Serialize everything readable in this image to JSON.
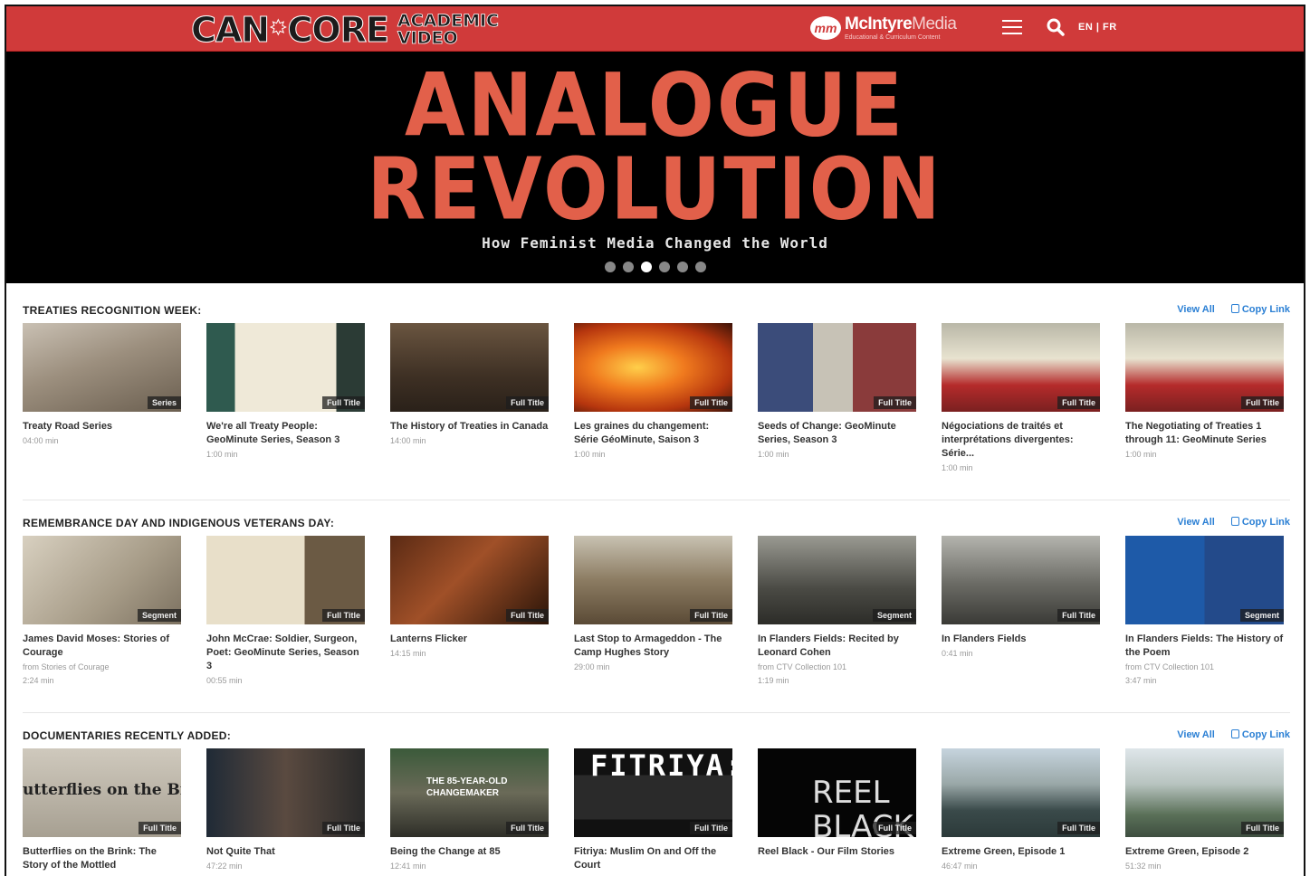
{
  "header": {
    "logo_main": "CAN",
    "logo_main2": "CORE",
    "logo_sub1": "ACADEMIC",
    "logo_sub2": "VIDEO",
    "partner_badge": "mm",
    "partner_name_bold": "McIntyre",
    "partner_name_light": "Media",
    "partner_tagline": "Educational & Curriculum Content",
    "language": "EN | FR"
  },
  "hero": {
    "line1": "ANALOGUE",
    "line2": "REVOLUTION",
    "subtitle": "How Feminist Media Changed the World",
    "slides": 6,
    "active_slide": 3
  },
  "sections": [
    {
      "title": "TREATIES RECOGNITION WEEK:",
      "view_all": "View All",
      "copy_link": "Copy Link",
      "cards": [
        {
          "title": "Treaty Road Series",
          "meta1": "04:00 min",
          "meta2": "",
          "badge": "Series",
          "thumb": "t-road"
        },
        {
          "title": "We're all Treaty People: GeoMinute Series, Season 3",
          "meta1": "1:00 min",
          "meta2": "",
          "badge": "Full Title",
          "thumb": "t-doc"
        },
        {
          "title": "The History of Treaties in Canada",
          "meta1": "14:00 min",
          "meta2": "",
          "badge": "Full Title",
          "thumb": "t-treat"
        },
        {
          "title": "Les graines du changement: Série GéoMinute, Saison 3",
          "meta1": "1:00 min",
          "meta2": "",
          "badge": "Full Title",
          "thumb": "t-fire"
        },
        {
          "title": "Seeds of Change: GeoMinute Series, Season 3",
          "meta1": "1:00 min",
          "meta2": "",
          "badge": "Full Title",
          "thumb": "t-seed"
        },
        {
          "title": "Négociations de traités et interprétations divergentes: Série...",
          "meta1": "1:00 min",
          "meta2": "",
          "badge": "Full Title",
          "thumb": "t-prot"
        },
        {
          "title": "The Negotiating of Treaties 1 through 11: GeoMinute Series",
          "meta1": "1:00 min",
          "meta2": "",
          "badge": "Full Title",
          "thumb": "t-prot"
        }
      ]
    },
    {
      "title": "REMEMBRANCE DAY AND INDIGENOUS VETERANS DAY:",
      "view_all": "View All",
      "copy_link": "Copy Link",
      "cards": [
        {
          "title": "James David Moses: Stories of Courage",
          "meta1": "from Stories of Courage",
          "meta2": "2:24 min",
          "badge": "Segment",
          "thumb": "t-sepia"
        },
        {
          "title": "John McCrae: Soldier, Surgeon, Poet: GeoMinute Series, Season 3",
          "meta1": "00:55 min",
          "meta2": "",
          "badge": "Full Title",
          "thumb": "t-letter"
        },
        {
          "title": "Lanterns Flicker",
          "meta1": "14:15 min",
          "meta2": "",
          "badge": "Full Title",
          "thumb": "t-guitar"
        },
        {
          "title": "Last Stop to Armageddon - The Camp Hughes Story",
          "meta1": "29:00 min",
          "meta2": "",
          "badge": "Full Title",
          "thumb": "t-war"
        },
        {
          "title": "In Flanders Fields: Recited by Leonard Cohen",
          "meta1": "from CTV Collection 101",
          "meta2": "1:19 min",
          "badge": "Segment",
          "thumb": "t-march"
        },
        {
          "title": "In Flanders Fields",
          "meta1": "0:41 min",
          "meta2": "",
          "badge": "Full Title",
          "thumb": "t-field"
        },
        {
          "title": "In Flanders Fields: The History of the Poem",
          "meta1": "from CTV Collection 101",
          "meta2": "3:47 min",
          "badge": "Segment",
          "thumb": "t-news"
        }
      ]
    },
    {
      "title": "DOCUMENTARIES RECENTLY ADDED:",
      "view_all": "View All",
      "copy_link": "Copy Link",
      "cards": [
        {
          "title": "Butterflies on the Brink: The Story of the Mottled",
          "meta1": "",
          "meta2": "",
          "badge": "Full Title",
          "thumb": "t-butter",
          "overlay": "utterflies on the Brin"
        },
        {
          "title": "Not Quite That",
          "meta1": "47:22 min",
          "meta2": "",
          "badge": "Full Title",
          "thumb": "t-faces"
        },
        {
          "title": "Being the Change at 85",
          "meta1": "12:41 min",
          "meta2": "",
          "badge": "Full Title",
          "thumb": "t-change",
          "overlay": "THE 85-YEAR-OLD CHANGEMAKER"
        },
        {
          "title": "Fitriya: Muslim On and Off the Court",
          "meta1": "",
          "meta2": "",
          "badge": "Full Title",
          "thumb": "t-fitr",
          "overlay": "FITRIYA:"
        },
        {
          "title": "Reel Black - Our Film Stories",
          "meta1": "",
          "meta2": "",
          "badge": "Full Title",
          "thumb": "t-reel",
          "overlay": "REEL BLACK"
        },
        {
          "title": "Extreme Green, Episode 1",
          "meta1": "46:47 min",
          "meta2": "",
          "badge": "Full Title",
          "thumb": "t-green1"
        },
        {
          "title": "Extreme Green, Episode 2",
          "meta1": "51:32 min",
          "meta2": "",
          "badge": "Full Title",
          "thumb": "t-green2"
        }
      ]
    }
  ]
}
